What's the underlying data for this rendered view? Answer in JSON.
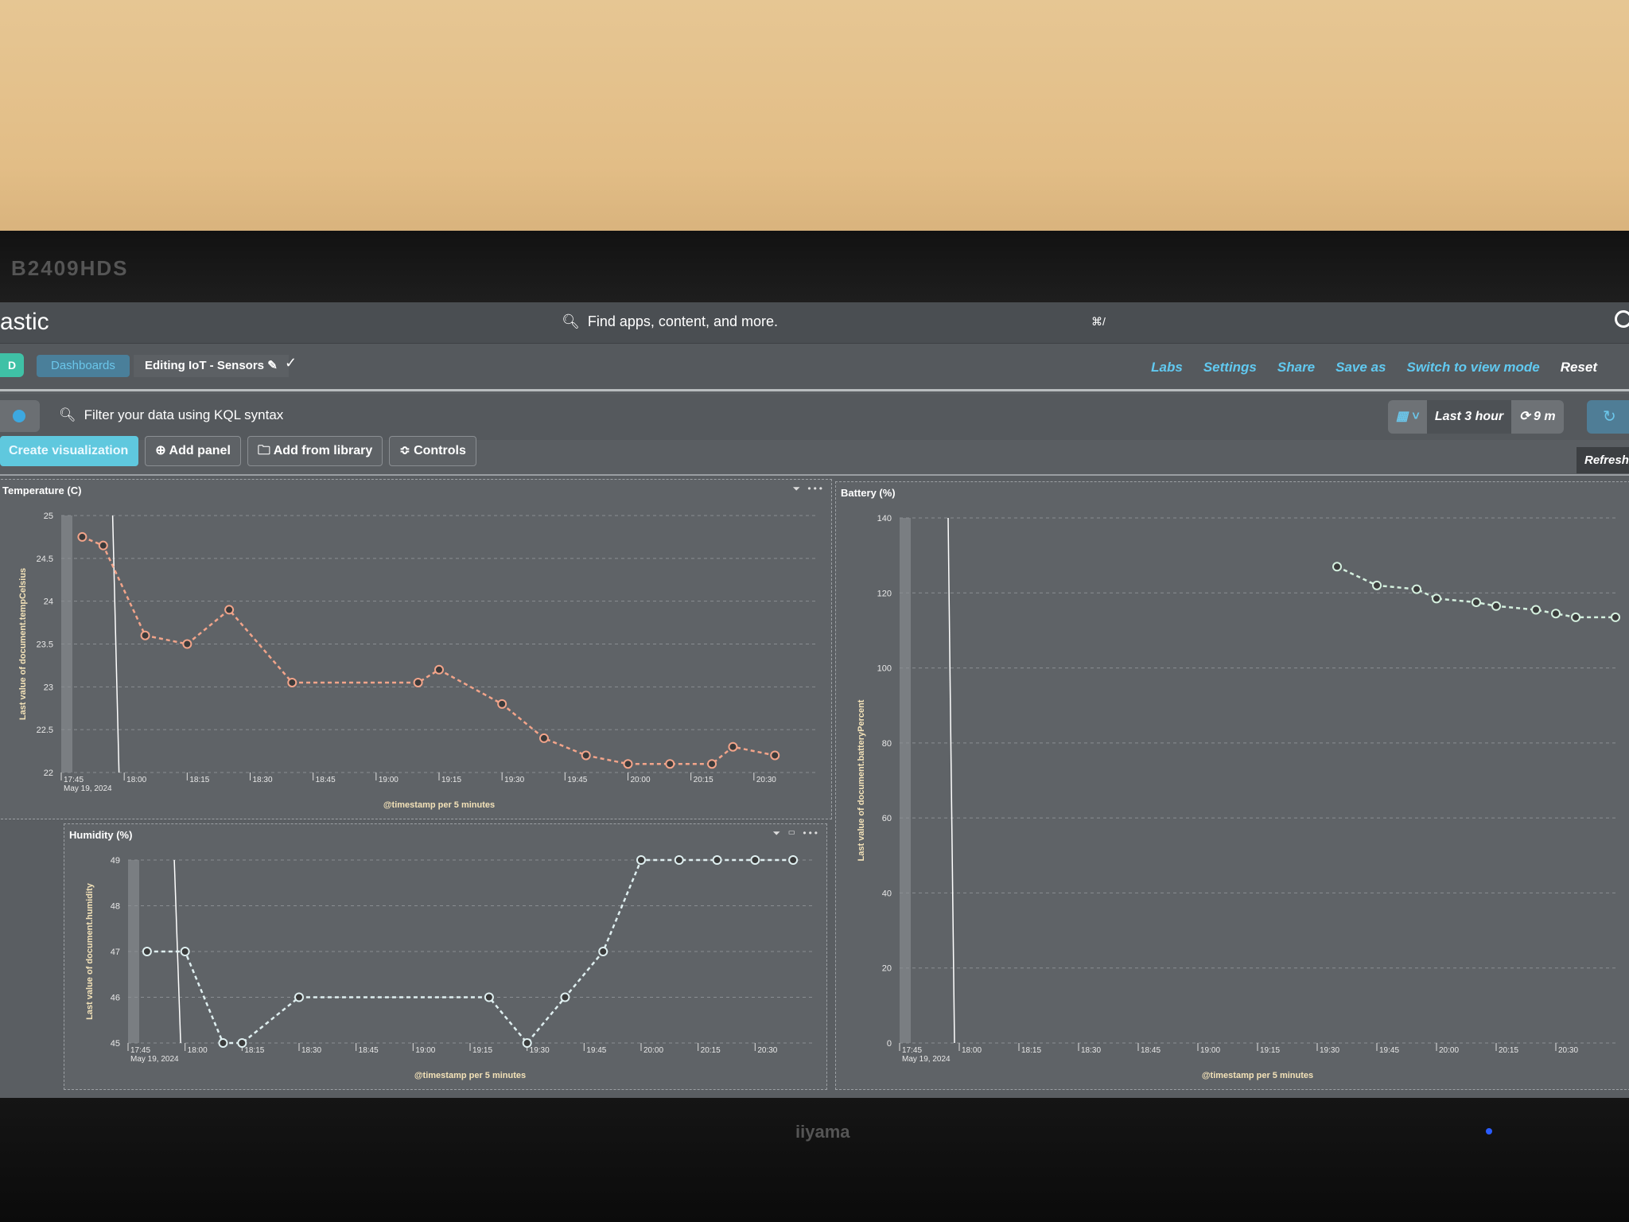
{
  "monitor": {
    "model": "B2409HDS",
    "brand": "iiyama"
  },
  "header": {
    "logo": "astic",
    "search_placeholder": "Find apps, content, and more.",
    "shortcut": "⌘/"
  },
  "breadcrumb": {
    "avatar": "D",
    "items": [
      "Dashboards",
      "Editing IoT - Sensors"
    ]
  },
  "top_nav": {
    "links": [
      "Labs",
      "Settings",
      "Share",
      "Save as",
      "Switch to view mode"
    ],
    "reset": "Reset"
  },
  "query": {
    "placeholder": "Filter your data using KQL syntax",
    "time_range": "Last 3 hour",
    "refresh_interval": "9 m",
    "refresh_tooltip": "Refresh"
  },
  "toolbar": {
    "create": "Create visualization",
    "add_panel": "Add panel",
    "add_library": "Add from library",
    "controls": "Controls"
  },
  "colors": {
    "accent": "#61c9f0",
    "temperature": "#f2a48a",
    "humidity": "#dfeff0",
    "battery": "#d5f0df"
  },
  "chart_data": [
    {
      "type": "line",
      "title": "Temperature (C)",
      "ylabel": "Last value of document.tempCelsius",
      "xlabel": "@timestamp per 5 minutes",
      "x_ticks": [
        "17:45\nMay 19, 2024",
        "18:00",
        "18:15",
        "18:30",
        "18:45",
        "19:00",
        "19:15",
        "19:30",
        "19:45",
        "20:00",
        "20:15",
        "20:30"
      ],
      "y_ticks": [
        22,
        22.5,
        23,
        23.5,
        24,
        24.5,
        25
      ],
      "ylim": [
        22,
        25
      ],
      "grid": true,
      "series": [
        {
          "x": [
            "17:50",
            "17:55",
            "18:05",
            "18:15",
            "18:25",
            "18:40",
            "19:10",
            "19:15",
            "19:30",
            "19:40",
            "19:50",
            "20:00",
            "20:10",
            "20:20",
            "20:25",
            "20:35"
          ],
          "y": [
            24.75,
            24.65,
            23.6,
            23.5,
            23.9,
            23.05,
            23.05,
            23.2,
            22.8,
            22.4,
            22.2,
            22.1,
            22.1,
            22.1,
            22.3,
            22.2
          ]
        }
      ]
    },
    {
      "type": "line",
      "title": "Humidity (%)",
      "ylabel": "Last value of document.humidity",
      "xlabel": "@timestamp per 5 minutes",
      "x_ticks": [
        "17:45\nMay 19, 2024",
        "18:00",
        "18:15",
        "18:30",
        "18:45",
        "19:00",
        "19:15",
        "19:30",
        "19:45",
        "20:00",
        "20:15",
        "20:30"
      ],
      "y_ticks": [
        45,
        46,
        47,
        48,
        49
      ],
      "ylim": [
        45,
        49
      ],
      "grid": true,
      "series": [
        {
          "x": [
            "17:50",
            "18:00",
            "18:10",
            "18:15",
            "18:30",
            "19:20",
            "19:30",
            "19:40",
            "19:50",
            "20:00",
            "20:10",
            "20:20",
            "20:30",
            "20:40"
          ],
          "y": [
            47,
            47,
            45,
            45,
            46,
            46,
            45,
            46,
            47,
            49,
            49,
            49,
            49,
            49
          ]
        }
      ]
    },
    {
      "type": "line",
      "title": "Battery (%)",
      "ylabel": "Last value of document.batteryPercent",
      "xlabel": "@timestamp per 5 minutes",
      "x_ticks": [
        "17:45\nMay 19, 2024",
        "18:00",
        "18:15",
        "18:30",
        "18:45",
        "19:00",
        "19:15",
        "19:30",
        "19:45",
        "20:00",
        "20:15",
        "20:30"
      ],
      "y_ticks": [
        0,
        20,
        40,
        60,
        80,
        100,
        120,
        140
      ],
      "ylim": [
        0,
        140
      ],
      "grid": true,
      "series": [
        {
          "x": [
            "19:35",
            "19:45",
            "19:55",
            "20:00",
            "20:10",
            "20:15",
            "20:25",
            "20:30",
            "20:35",
            "20:45"
          ],
          "y": [
            127,
            122,
            121,
            118.5,
            117.5,
            116.5,
            115.5,
            114.5,
            113.5,
            113.5
          ]
        }
      ]
    }
  ]
}
